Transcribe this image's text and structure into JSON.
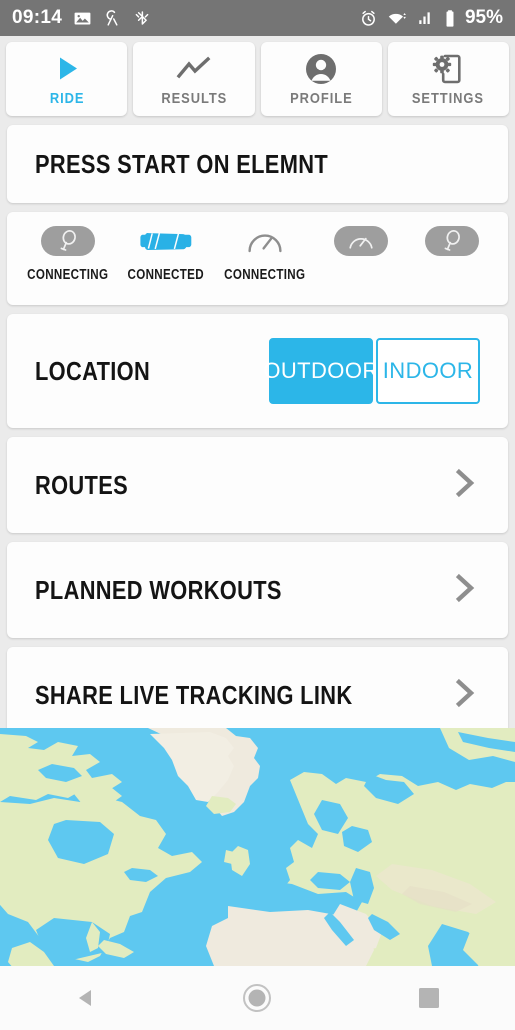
{
  "status_bar": {
    "time": "09:14",
    "battery_percent": "95%",
    "icons": [
      "screenshot-icon",
      "ant-plus-icon",
      "bluetooth-disabled-icon",
      "alarm-icon",
      "wifi-icon",
      "cellular-signal-icon",
      "battery-icon"
    ],
    "background": "#757575",
    "foreground": "#ffffff"
  },
  "tabs": [
    {
      "label": "RIDE",
      "icon": "play-icon",
      "active": true
    },
    {
      "label": "RESULTS",
      "icon": "chart-line-icon",
      "active": false
    },
    {
      "label": "PROFILE",
      "icon": "person-icon",
      "active": false
    },
    {
      "label": "SETTINGS",
      "icon": "device-gear-icon",
      "active": false
    }
  ],
  "banner": {
    "title": "PRESS START ON ELEMNT"
  },
  "sensors": [
    {
      "icon": "power-meter-icon",
      "status": "CONNECTING",
      "connected": false
    },
    {
      "icon": "heart-rate-strap-icon",
      "status": "CONNECTED",
      "connected": true
    },
    {
      "icon": "speed-gauge-icon",
      "status": "CONNECTING",
      "connected": false
    },
    {
      "icon": "speed-gauge-icon",
      "status": "",
      "connected": false
    },
    {
      "icon": "power-meter-icon",
      "status": "",
      "connected": false
    }
  ],
  "location": {
    "title": "LOCATION",
    "options": [
      {
        "label": "OUTDOOR",
        "selected": true
      },
      {
        "label": "INDOOR",
        "selected": false
      }
    ]
  },
  "nav_rows": [
    {
      "title": "ROUTES",
      "icon": "chevron-right-icon"
    },
    {
      "title": "PLANNED WORKOUTS",
      "icon": "chevron-right-icon"
    },
    {
      "title": "SHARE LIVE TRACKING LINK",
      "icon": "chevron-right-icon"
    }
  ],
  "map": {
    "water_color": "#5ec8f0",
    "land_color": "#e2ecc0",
    "desert_color": "#efeade",
    "region": "North Atlantic"
  },
  "android_nav": [
    {
      "icon": "back-triangle-icon"
    },
    {
      "icon": "home-circle-icon"
    },
    {
      "icon": "recents-square-icon"
    }
  ],
  "theme": {
    "accent": "#2cb6e8",
    "card": "#fdfdfd",
    "page_background": "#ebebeb",
    "muted": "#9e9e9e"
  }
}
